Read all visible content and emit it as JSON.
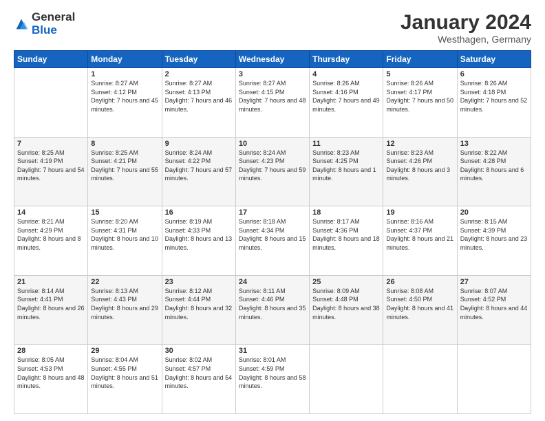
{
  "logo": {
    "general": "General",
    "blue": "Blue"
  },
  "title": {
    "month_year": "January 2024",
    "location": "Westhagen, Germany"
  },
  "headers": [
    "Sunday",
    "Monday",
    "Tuesday",
    "Wednesday",
    "Thursday",
    "Friday",
    "Saturday"
  ],
  "weeks": [
    [
      {
        "day": "",
        "sunrise": "",
        "sunset": "",
        "daylight": ""
      },
      {
        "day": "1",
        "sunrise": "Sunrise: 8:27 AM",
        "sunset": "Sunset: 4:12 PM",
        "daylight": "Daylight: 7 hours and 45 minutes."
      },
      {
        "day": "2",
        "sunrise": "Sunrise: 8:27 AM",
        "sunset": "Sunset: 4:13 PM",
        "daylight": "Daylight: 7 hours and 46 minutes."
      },
      {
        "day": "3",
        "sunrise": "Sunrise: 8:27 AM",
        "sunset": "Sunset: 4:15 PM",
        "daylight": "Daylight: 7 hours and 48 minutes."
      },
      {
        "day": "4",
        "sunrise": "Sunrise: 8:26 AM",
        "sunset": "Sunset: 4:16 PM",
        "daylight": "Daylight: 7 hours and 49 minutes."
      },
      {
        "day": "5",
        "sunrise": "Sunrise: 8:26 AM",
        "sunset": "Sunset: 4:17 PM",
        "daylight": "Daylight: 7 hours and 50 minutes."
      },
      {
        "day": "6",
        "sunrise": "Sunrise: 8:26 AM",
        "sunset": "Sunset: 4:18 PM",
        "daylight": "Daylight: 7 hours and 52 minutes."
      }
    ],
    [
      {
        "day": "7",
        "sunrise": "Sunrise: 8:25 AM",
        "sunset": "Sunset: 4:19 PM",
        "daylight": "Daylight: 7 hours and 54 minutes."
      },
      {
        "day": "8",
        "sunrise": "Sunrise: 8:25 AM",
        "sunset": "Sunset: 4:21 PM",
        "daylight": "Daylight: 7 hours and 55 minutes."
      },
      {
        "day": "9",
        "sunrise": "Sunrise: 8:24 AM",
        "sunset": "Sunset: 4:22 PM",
        "daylight": "Daylight: 7 hours and 57 minutes."
      },
      {
        "day": "10",
        "sunrise": "Sunrise: 8:24 AM",
        "sunset": "Sunset: 4:23 PM",
        "daylight": "Daylight: 7 hours and 59 minutes."
      },
      {
        "day": "11",
        "sunrise": "Sunrise: 8:23 AM",
        "sunset": "Sunset: 4:25 PM",
        "daylight": "Daylight: 8 hours and 1 minute."
      },
      {
        "day": "12",
        "sunrise": "Sunrise: 8:23 AM",
        "sunset": "Sunset: 4:26 PM",
        "daylight": "Daylight: 8 hours and 3 minutes."
      },
      {
        "day": "13",
        "sunrise": "Sunrise: 8:22 AM",
        "sunset": "Sunset: 4:28 PM",
        "daylight": "Daylight: 8 hours and 6 minutes."
      }
    ],
    [
      {
        "day": "14",
        "sunrise": "Sunrise: 8:21 AM",
        "sunset": "Sunset: 4:29 PM",
        "daylight": "Daylight: 8 hours and 8 minutes."
      },
      {
        "day": "15",
        "sunrise": "Sunrise: 8:20 AM",
        "sunset": "Sunset: 4:31 PM",
        "daylight": "Daylight: 8 hours and 10 minutes."
      },
      {
        "day": "16",
        "sunrise": "Sunrise: 8:19 AM",
        "sunset": "Sunset: 4:33 PM",
        "daylight": "Daylight: 8 hours and 13 minutes."
      },
      {
        "day": "17",
        "sunrise": "Sunrise: 8:18 AM",
        "sunset": "Sunset: 4:34 PM",
        "daylight": "Daylight: 8 hours and 15 minutes."
      },
      {
        "day": "18",
        "sunrise": "Sunrise: 8:17 AM",
        "sunset": "Sunset: 4:36 PM",
        "daylight": "Daylight: 8 hours and 18 minutes."
      },
      {
        "day": "19",
        "sunrise": "Sunrise: 8:16 AM",
        "sunset": "Sunset: 4:37 PM",
        "daylight": "Daylight: 8 hours and 21 minutes."
      },
      {
        "day": "20",
        "sunrise": "Sunrise: 8:15 AM",
        "sunset": "Sunset: 4:39 PM",
        "daylight": "Daylight: 8 hours and 23 minutes."
      }
    ],
    [
      {
        "day": "21",
        "sunrise": "Sunrise: 8:14 AM",
        "sunset": "Sunset: 4:41 PM",
        "daylight": "Daylight: 8 hours and 26 minutes."
      },
      {
        "day": "22",
        "sunrise": "Sunrise: 8:13 AM",
        "sunset": "Sunset: 4:43 PM",
        "daylight": "Daylight: 8 hours and 29 minutes."
      },
      {
        "day": "23",
        "sunrise": "Sunrise: 8:12 AM",
        "sunset": "Sunset: 4:44 PM",
        "daylight": "Daylight: 8 hours and 32 minutes."
      },
      {
        "day": "24",
        "sunrise": "Sunrise: 8:11 AM",
        "sunset": "Sunset: 4:46 PM",
        "daylight": "Daylight: 8 hours and 35 minutes."
      },
      {
        "day": "25",
        "sunrise": "Sunrise: 8:09 AM",
        "sunset": "Sunset: 4:48 PM",
        "daylight": "Daylight: 8 hours and 38 minutes."
      },
      {
        "day": "26",
        "sunrise": "Sunrise: 8:08 AM",
        "sunset": "Sunset: 4:50 PM",
        "daylight": "Daylight: 8 hours and 41 minutes."
      },
      {
        "day": "27",
        "sunrise": "Sunrise: 8:07 AM",
        "sunset": "Sunset: 4:52 PM",
        "daylight": "Daylight: 8 hours and 44 minutes."
      }
    ],
    [
      {
        "day": "28",
        "sunrise": "Sunrise: 8:05 AM",
        "sunset": "Sunset: 4:53 PM",
        "daylight": "Daylight: 8 hours and 48 minutes."
      },
      {
        "day": "29",
        "sunrise": "Sunrise: 8:04 AM",
        "sunset": "Sunset: 4:55 PM",
        "daylight": "Daylight: 8 hours and 51 minutes."
      },
      {
        "day": "30",
        "sunrise": "Sunrise: 8:02 AM",
        "sunset": "Sunset: 4:57 PM",
        "daylight": "Daylight: 8 hours and 54 minutes."
      },
      {
        "day": "31",
        "sunrise": "Sunrise: 8:01 AM",
        "sunset": "Sunset: 4:59 PM",
        "daylight": "Daylight: 8 hours and 58 minutes."
      },
      {
        "day": "",
        "sunrise": "",
        "sunset": "",
        "daylight": ""
      },
      {
        "day": "",
        "sunrise": "",
        "sunset": "",
        "daylight": ""
      },
      {
        "day": "",
        "sunrise": "",
        "sunset": "",
        "daylight": ""
      }
    ]
  ]
}
